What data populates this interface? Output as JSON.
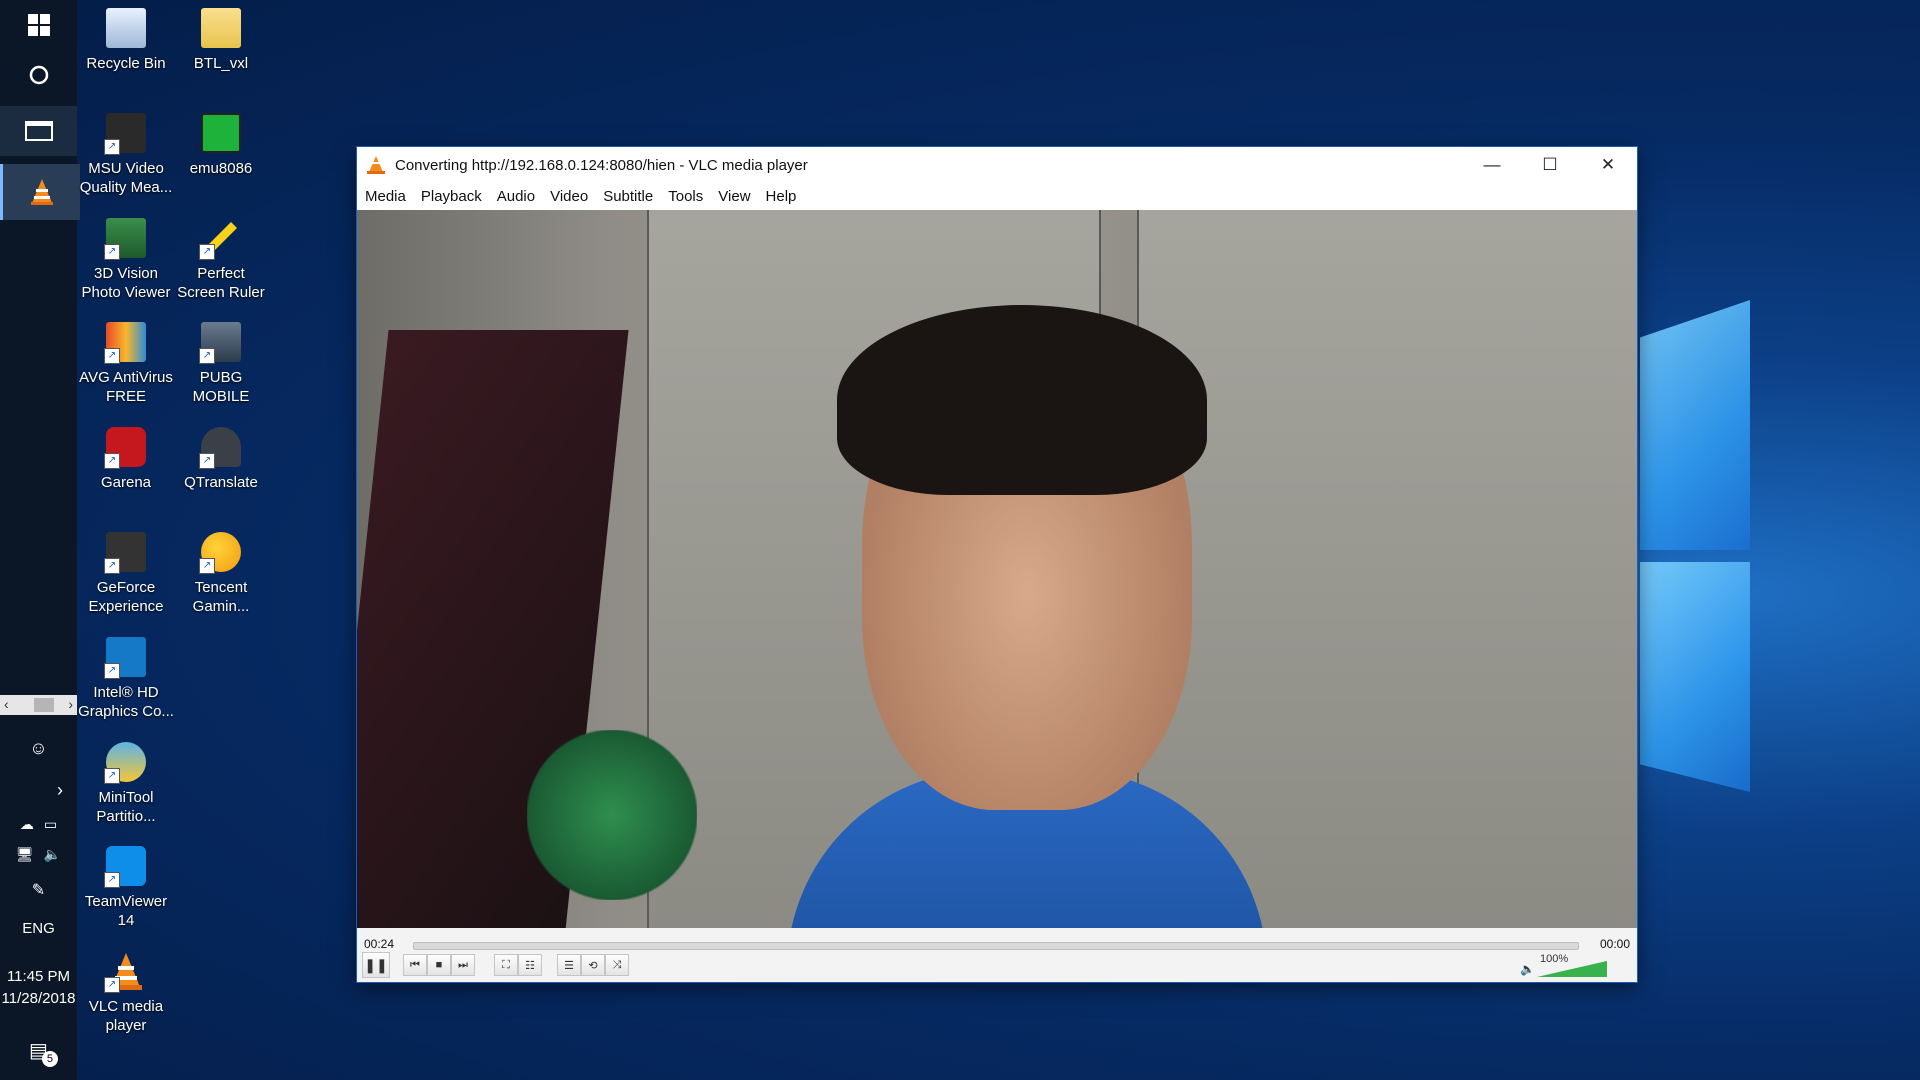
{
  "taskbar": {
    "time": "11:45 PM",
    "date": "11/28/2018",
    "language": "ENG",
    "notification_count": "5"
  },
  "desktop_icons": [
    {
      "label": "Recycle Bin",
      "icon": "recycle-bin-icon"
    },
    {
      "label": "BTL_vxl",
      "icon": "folder-icon"
    },
    {
      "label": "MSU Video Quality Mea...",
      "icon": "msu-icon"
    },
    {
      "label": "emu8086",
      "icon": "chip-icon"
    },
    {
      "label": "3D Vision Photo Viewer",
      "icon": "photo-viewer-icon"
    },
    {
      "label": "Perfect Screen Ruler",
      "icon": "ruler-icon"
    },
    {
      "label": "AVG AntiVirus FREE",
      "icon": "avg-icon"
    },
    {
      "label": "PUBG MOBILE",
      "icon": "pubg-icon"
    },
    {
      "label": "Garena",
      "icon": "garena-icon"
    },
    {
      "label": "QTranslate",
      "icon": "qtranslate-icon"
    },
    {
      "label": "GeForce Experience",
      "icon": "geforce-icon"
    },
    {
      "label": "Tencent Gamin...",
      "icon": "tencent-icon"
    },
    {
      "label": "Intel® HD Graphics Co...",
      "icon": "intel-icon"
    },
    {
      "label": "MiniTool Partitio...",
      "icon": "minitool-icon"
    },
    {
      "label": "TeamViewer 14",
      "icon": "teamviewer-icon"
    },
    {
      "label": "VLC media player",
      "icon": "vlc-icon"
    }
  ],
  "vlc": {
    "title": "Converting http://192.168.0.124:8080/hien - VLC media player",
    "menu": [
      "Media",
      "Playback",
      "Audio",
      "Video",
      "Subtitle",
      "Tools",
      "View",
      "Help"
    ],
    "elapsed": "00:24",
    "remaining": "00:00",
    "volume": "100%",
    "volume_level": 1.0
  }
}
